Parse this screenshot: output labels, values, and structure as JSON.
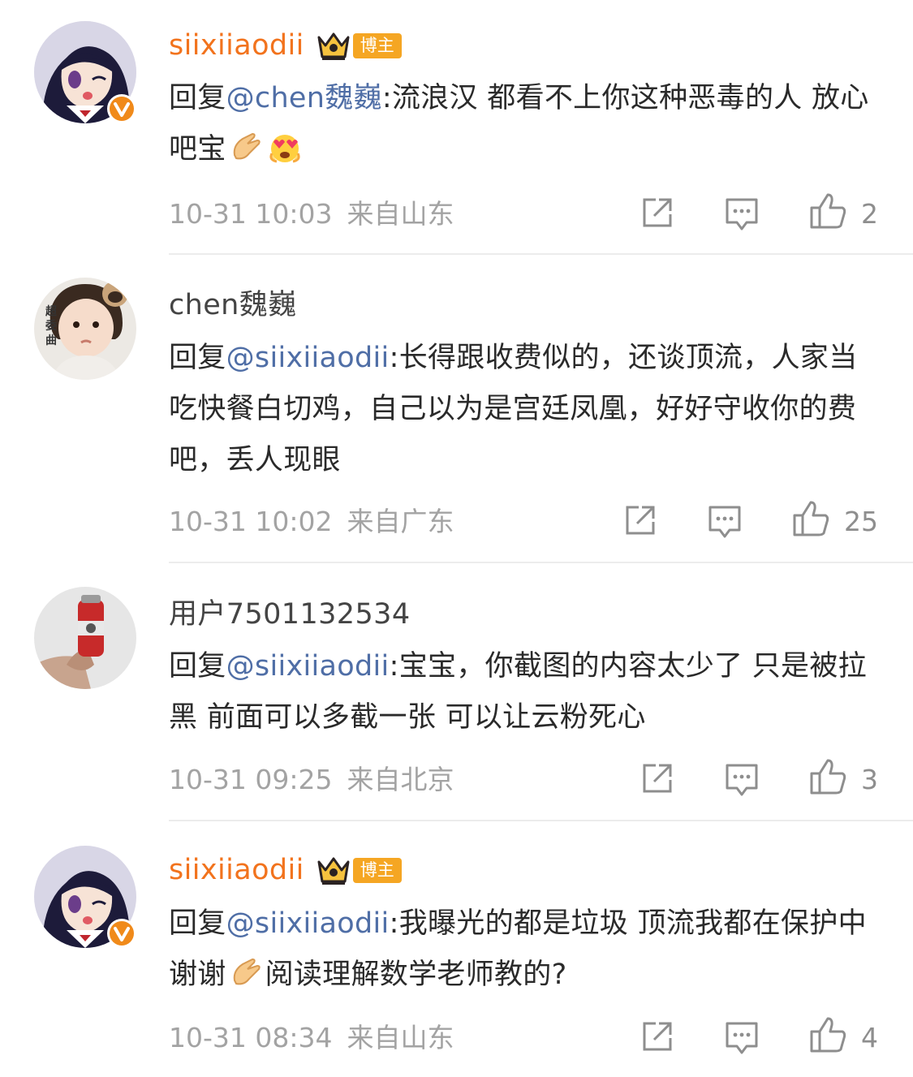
{
  "colors": {
    "vip_name": "#f2731d",
    "mention": "#4f6ea6",
    "meta": "#a3a3a3",
    "tag_bg": "#f5a623",
    "verified": "#f08a1a"
  },
  "comments": [
    {
      "avatar": "anime-girl-avatar",
      "verified": true,
      "username": "siixiiaodii",
      "is_blogger": true,
      "crown_icon": "crown-icon",
      "tag": "博主",
      "reply_prefix": "回复",
      "mention": "@chen魏巍",
      "colon": ":",
      "text": "流浪汉  都看不上你这种恶毒的人 放心吧宝",
      "emojis": [
        "clasped-hands-emoji",
        "heart-eyes-emoji"
      ],
      "time": "10-31 10:03",
      "location": "来自山东",
      "likes": "2"
    },
    {
      "avatar": "toddler-photo-avatar",
      "avatar_text": "超委曲",
      "verified": false,
      "username": "chen魏巍",
      "is_blogger": false,
      "reply_prefix": "回复",
      "mention": "@siixiiaodii",
      "colon": ":",
      "text": "长得跟收费似的，还谈顶流，人家当吃快餐白切鸡，自己以为是宫廷凤凰，好好守收你的费吧，丢人现眼",
      "time": "10-31 10:02",
      "location": "来自广东",
      "likes": "25"
    },
    {
      "avatar": "hand-holding-can-avatar",
      "verified": false,
      "username": "用户7501132534",
      "is_blogger": false,
      "reply_prefix": "回复",
      "mention": "@siixiiaodii",
      "colon": ":",
      "text": "宝宝，你截图的内容太少了 只是被拉黑 前面可以多截一张 可以让云粉死心",
      "time": "10-31 09:25",
      "location": "来自北京",
      "likes": "3"
    },
    {
      "avatar": "anime-girl-avatar",
      "verified": true,
      "username": "siixiiaodii",
      "is_blogger": true,
      "crown_icon": "crown-icon",
      "tag": "博主",
      "reply_prefix": "回复",
      "mention": "@siixiiaodii",
      "colon": ":",
      "text_a": "我曝光的都是垃圾 顶流我都在保护中 谢谢",
      "emojis": [
        "clasped-hands-emoji"
      ],
      "text_b": "阅读理解数学老师教的?",
      "time": "10-31 08:34",
      "location": "来自山东",
      "likes": "4"
    }
  ],
  "icons": {
    "share": "share-icon",
    "reply": "comment-icon",
    "like": "like-icon"
  }
}
